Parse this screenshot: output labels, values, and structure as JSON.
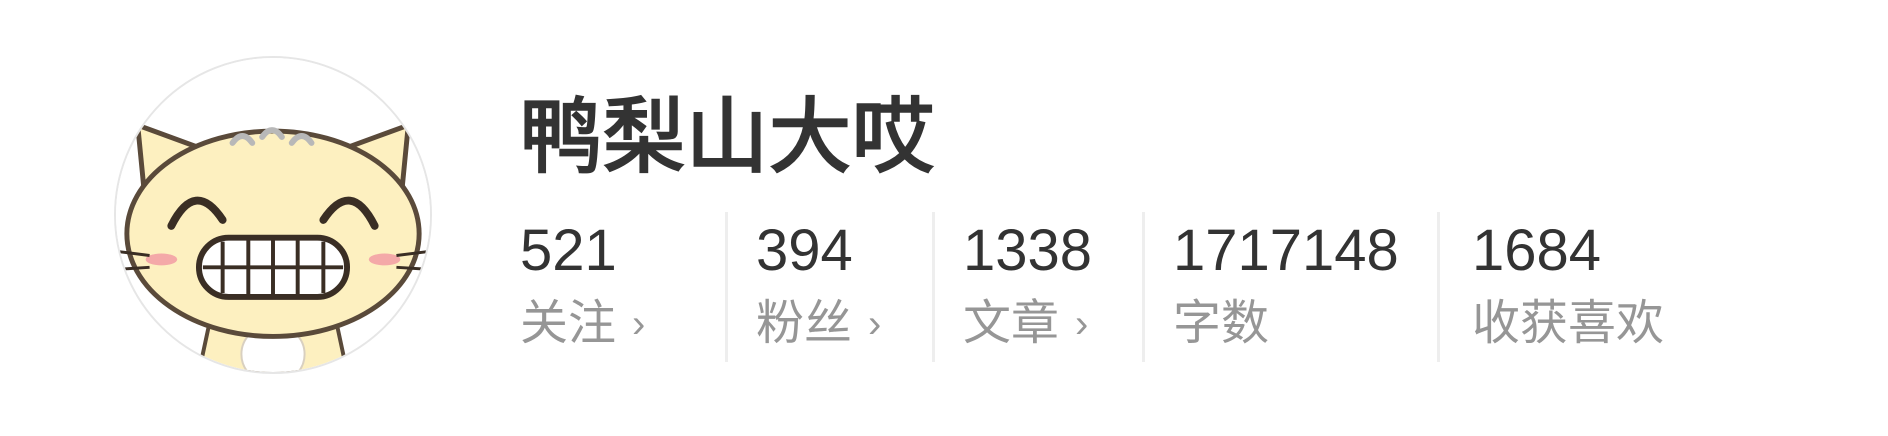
{
  "user": {
    "name": "鸭梨山大哎",
    "avatar_icon": "cartoon-cat-avatar-icon"
  },
  "stats": [
    {
      "count": "521",
      "label": "关注",
      "has_arrow": true
    },
    {
      "count": "394",
      "label": "粉丝",
      "has_arrow": true
    },
    {
      "count": "1338",
      "label": "文章",
      "has_arrow": true
    },
    {
      "count": "1717148",
      "label": "字数",
      "has_arrow": false
    },
    {
      "count": "1684",
      "label": "收获喜欢",
      "has_arrow": false
    }
  ],
  "arrow_glyph": "›",
  "colors": {
    "name": "#333333",
    "count": "#333333",
    "label": "#969696",
    "divider": "#eeeeee"
  }
}
